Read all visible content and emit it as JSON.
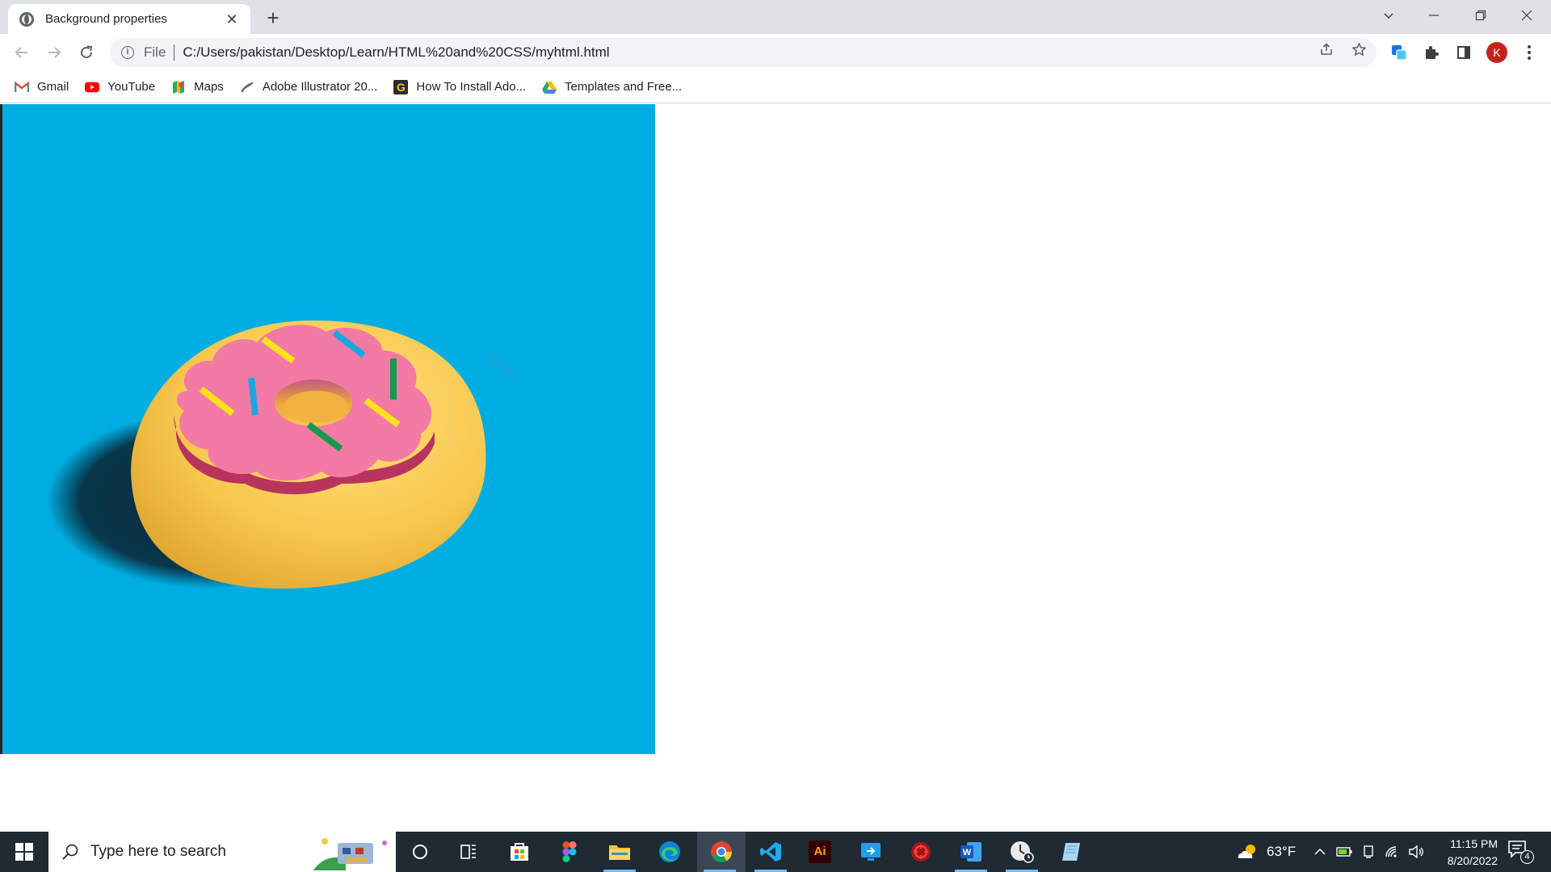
{
  "browser": {
    "tab": {
      "title": "Background properties",
      "close_icon": "close-icon"
    },
    "new_tab_icon": "plus-icon",
    "window_controls": [
      "chevron-down-icon",
      "minimize-icon",
      "restore-icon",
      "close-icon"
    ]
  },
  "toolbar": {
    "scheme_label": "File",
    "url": "C:/Users/pakistan/Desktop/Learn/HTML%20and%20CSS/myhtml.html",
    "profile_initial": "K"
  },
  "bookmarks": [
    {
      "label": "Gmail",
      "icon": "gmail-icon"
    },
    {
      "label": "YouTube",
      "icon": "youtube-icon"
    },
    {
      "label": "Maps",
      "icon": "maps-icon"
    },
    {
      "label": "Adobe Illustrator 20...",
      "icon": "illustrator-feather-icon"
    },
    {
      "label": "How To Install Ado...",
      "icon": "g-icon"
    },
    {
      "label": "Templates and Free...",
      "icon": "drive-icon"
    }
  ],
  "page": {
    "background_color": "#00ade2",
    "image": "donut-illustration"
  },
  "taskbar": {
    "search_placeholder": "Type here to search",
    "weather_temp": "63°F",
    "time": "11:15 PM",
    "date": "8/20/2022",
    "notification_count": "4",
    "pinned_apps": [
      "cortana-icon",
      "task-view-icon",
      "store-icon",
      "figma-icon",
      "file-explorer-icon",
      "edge-icon",
      "chrome-icon",
      "vscode-icon",
      "illustrator-icon",
      "screen-share-icon",
      "app-red-icon",
      "word-icon",
      "clock-app-icon",
      "notes-app-icon"
    ]
  }
}
